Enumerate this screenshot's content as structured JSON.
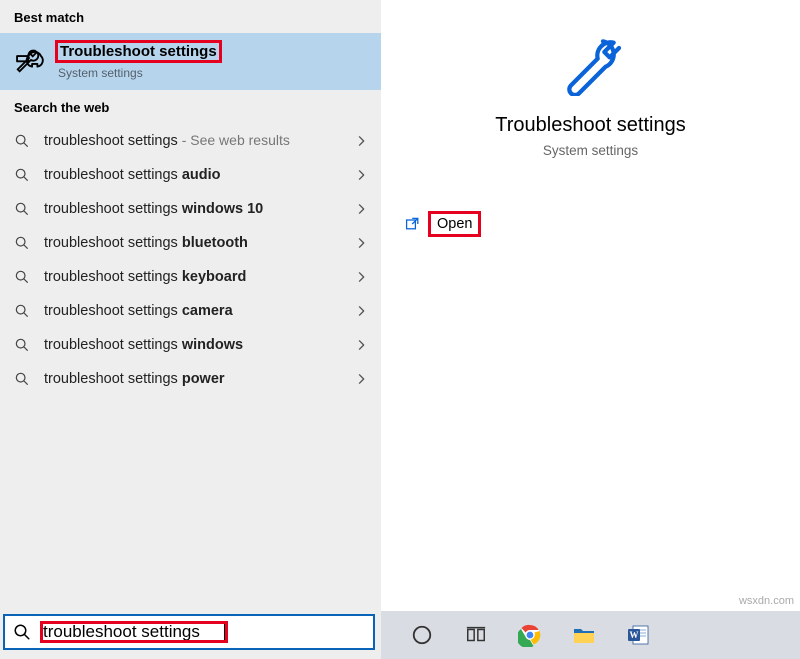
{
  "left": {
    "best_match_header": "Best match",
    "best_match": {
      "title": "Troubleshoot settings",
      "subtitle": "System settings"
    },
    "web_header": "Search the web",
    "web_items": [
      {
        "prefix": "troubleshoot settings",
        "bold": "",
        "hint": " - See web results"
      },
      {
        "prefix": "troubleshoot settings ",
        "bold": "audio",
        "hint": ""
      },
      {
        "prefix": "troubleshoot settings ",
        "bold": "windows 10",
        "hint": ""
      },
      {
        "prefix": "troubleshoot settings ",
        "bold": "bluetooth",
        "hint": ""
      },
      {
        "prefix": "troubleshoot settings ",
        "bold": "keyboard",
        "hint": ""
      },
      {
        "prefix": "troubleshoot settings ",
        "bold": "camera",
        "hint": ""
      },
      {
        "prefix": "troubleshoot settings ",
        "bold": "windows",
        "hint": ""
      },
      {
        "prefix": "troubleshoot settings ",
        "bold": "power",
        "hint": ""
      }
    ],
    "search_value": "troubleshoot settings"
  },
  "right": {
    "title": "Troubleshoot settings",
    "subtitle": "System settings",
    "open_label": "Open"
  },
  "watermark": "wsxdn.com"
}
